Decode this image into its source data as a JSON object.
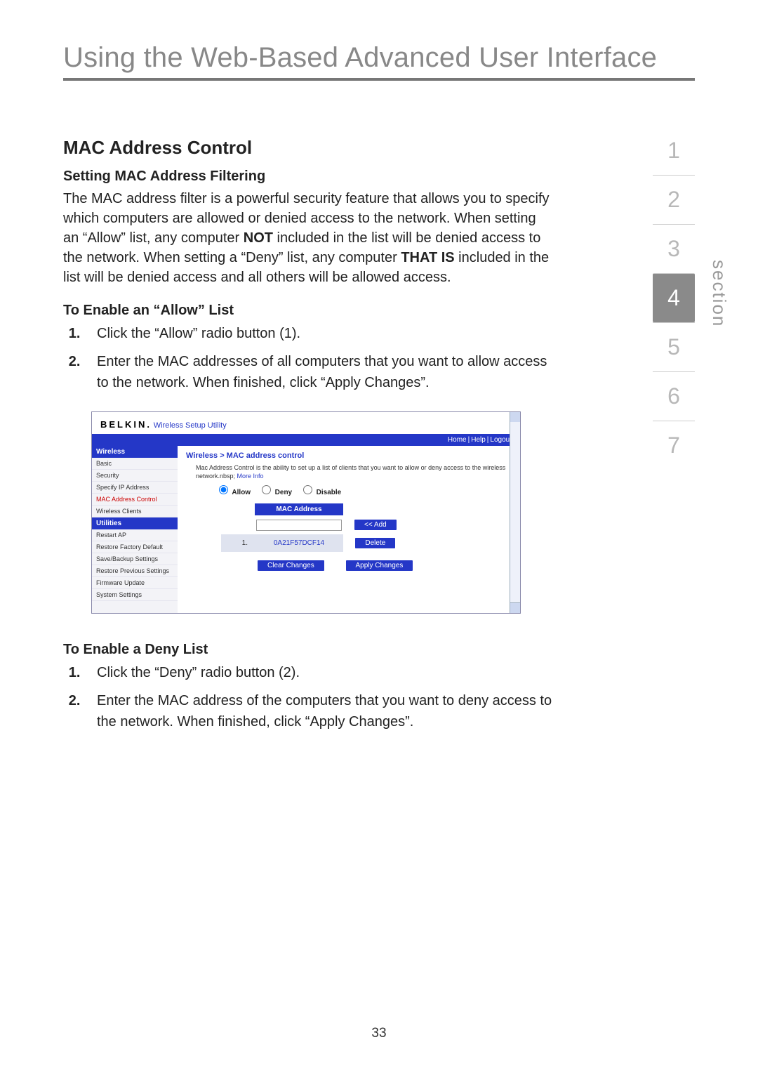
{
  "page": {
    "header": "Using the Web-Based Advanced User Interface",
    "page_number": "33"
  },
  "section_nav": {
    "items": [
      "1",
      "2",
      "3",
      "4",
      "5",
      "6",
      "7"
    ],
    "current_index": 3,
    "label": "section"
  },
  "doc": {
    "h2": "MAC Address Control",
    "h3a": "Setting MAC Address Filtering",
    "para_parts": [
      "The MAC address filter is a powerful security feature that allows you to specify which computers are allowed or denied access to the network. When setting an “Allow” list, any computer ",
      "NOT",
      " included in the list will be denied access to the network. When setting a “Deny” list, any computer ",
      "THAT IS",
      " included in the list will be denied access and all others will be allowed access."
    ],
    "h3b": "To Enable an “Allow” List",
    "allow_steps": [
      "Click the “Allow” radio button (1).",
      "Enter the MAC addresses of all computers that you want to allow access to the network. When finished, click “Apply Changes”."
    ],
    "h3c": "To Enable a Deny List",
    "deny_steps": [
      "Click the “Deny” radio button (2).",
      "Enter the MAC address of the computers that you want to deny access to the network. When finished, click “Apply Changes”."
    ]
  },
  "shot": {
    "brand": "BELKIN.",
    "utility": "Wireless Setup Utility",
    "topnav": {
      "home": "Home",
      "help": "Help",
      "logout": "Logout"
    },
    "side": {
      "head1": "Wireless",
      "items1": [
        "Basic",
        "Security",
        "Specify IP Address",
        "MAC Address Control",
        "Wireless Clients"
      ],
      "selected1": 3,
      "head2": "Utilities",
      "items2": [
        "Restart AP",
        "Restore Factory Default",
        "Save/Backup Settings",
        "Restore Previous Settings",
        "Firmware Update",
        "System Settings"
      ]
    },
    "main": {
      "crumb": "Wireless > MAC address control",
      "desc": "Mac Address Control is the ability to set up a list of clients that you want to allow or deny access to the wireless network.nbsp; ",
      "more": "More Info",
      "radios": {
        "allow": "Allow",
        "deny": "Deny",
        "disable": "Disable",
        "selected": "allow"
      },
      "table": {
        "header": "MAC Address",
        "add": "<< Add",
        "rows": [
          {
            "idx": "1.",
            "mac": "0A21F57DCF14",
            "action": "Delete"
          }
        ]
      },
      "clear": "Clear Changes",
      "apply": "Apply Changes"
    }
  }
}
